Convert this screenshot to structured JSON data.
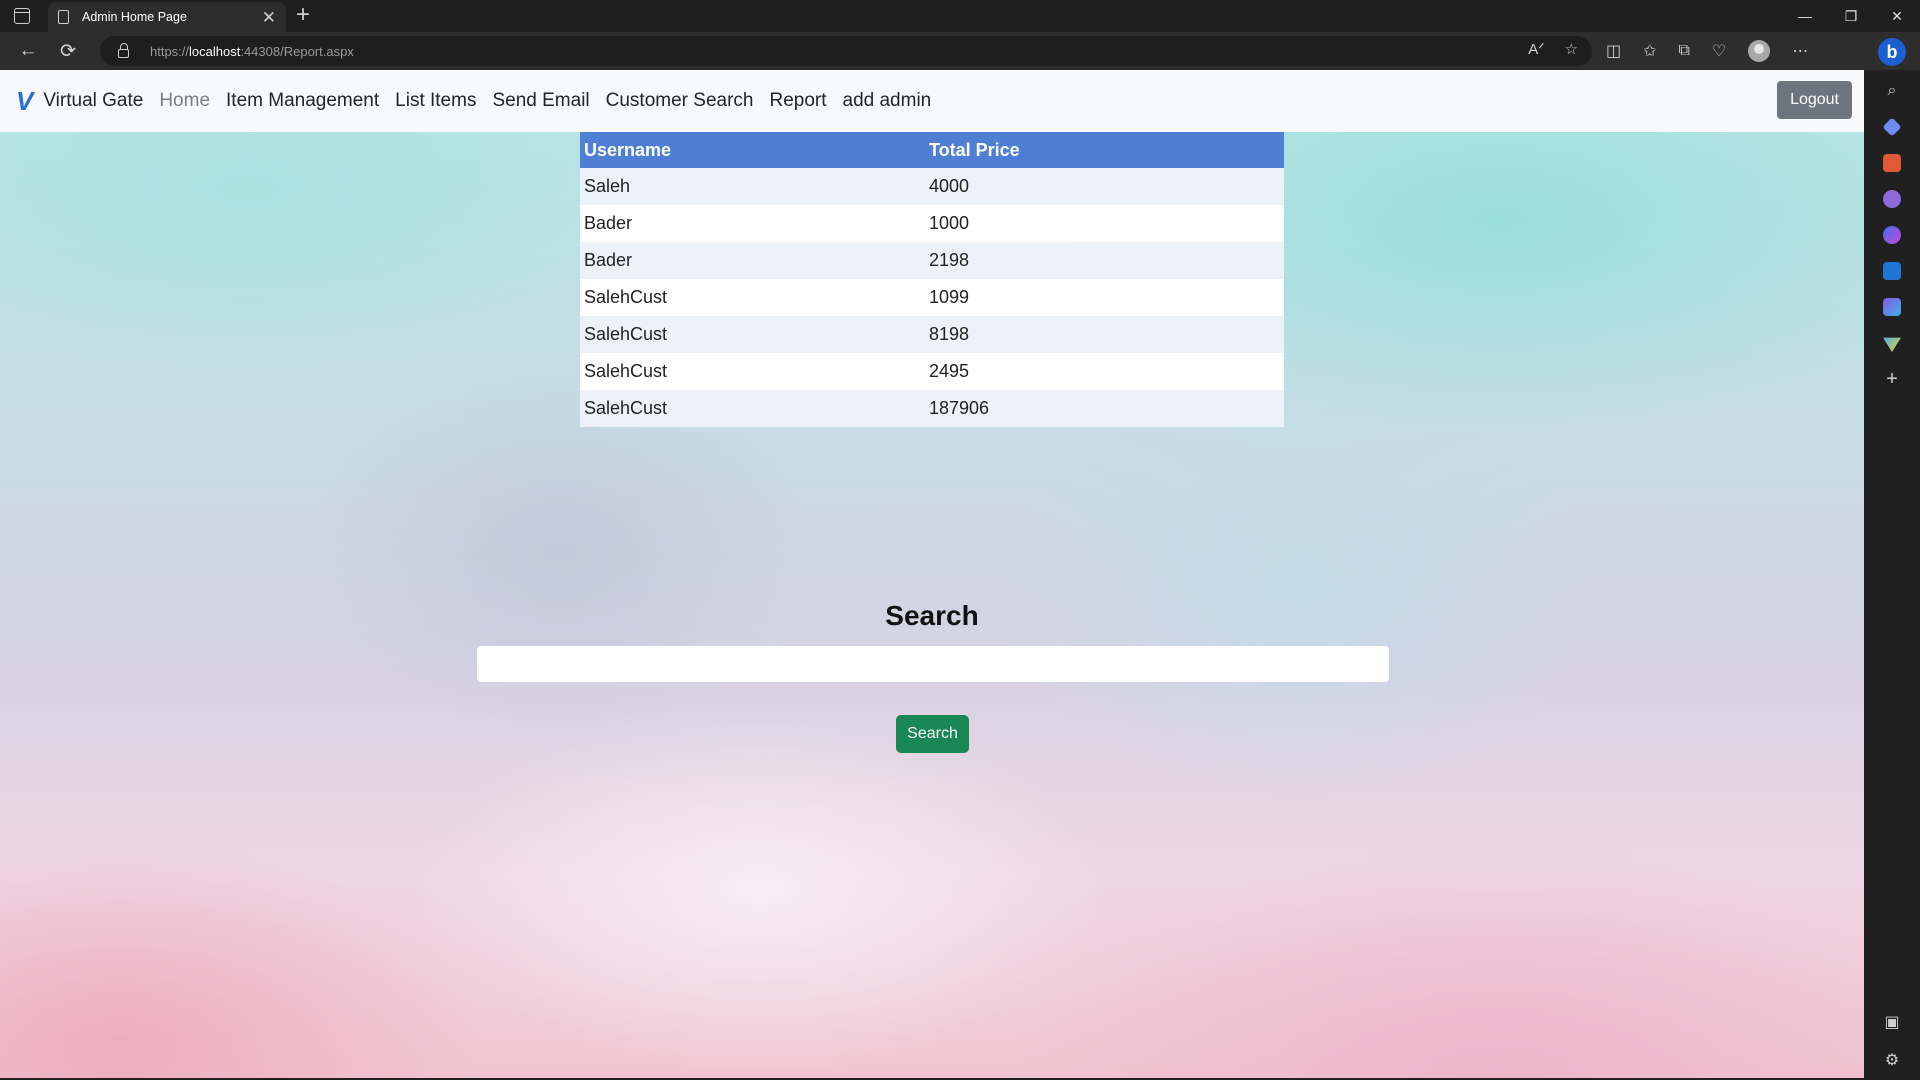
{
  "browser": {
    "tab_title": "Admin Home Page",
    "tab_close": "✕",
    "new_tab": "+",
    "url_prefix": "https://",
    "url_host": "localhost",
    "url_rest": ":44308/Report.aspx",
    "window_controls": [
      "—",
      "❐",
      "✕"
    ],
    "toolbar_icons": [
      "read-aloud-icon",
      "favorite-star-icon",
      "split-screen-icon",
      "favorites-icon",
      "collections-icon",
      "browser-essentials-icon",
      "profile-icon",
      "more-icon"
    ],
    "copilot_letter": "b",
    "sidebar_icons": [
      "search-icon",
      "shopping-tag-icon",
      "tools-icon",
      "games-icon",
      "microsoft365-icon",
      "outlook-icon",
      "designer-icon",
      "drop-icon",
      "add-icon"
    ]
  },
  "navbar": {
    "brand_logo": "V",
    "brand_name": "Virtual Gate",
    "links": [
      "Home",
      "Item Management",
      "List Items",
      "Send Email",
      "Customer Search",
      "Report",
      "add admin"
    ],
    "active_link": "Home",
    "logout_label": "Logout"
  },
  "report": {
    "columns": [
      "Username",
      "Total Price"
    ],
    "rows": [
      [
        "Saleh",
        "4000"
      ],
      [
        "Bader",
        "1000"
      ],
      [
        "Bader",
        "2198"
      ],
      [
        "SalehCust",
        "1099"
      ],
      [
        "SalehCust",
        "8198"
      ],
      [
        "SalehCust",
        "2495"
      ],
      [
        "SalehCust",
        "187906"
      ]
    ]
  },
  "search": {
    "heading": "Search",
    "input_value": "",
    "button_label": "Search"
  },
  "colors": {
    "brand_blue": "#2b6fd6",
    "table_header": "#4f7fd4",
    "search_button": "#198754",
    "logout_button": "#6c757d"
  }
}
